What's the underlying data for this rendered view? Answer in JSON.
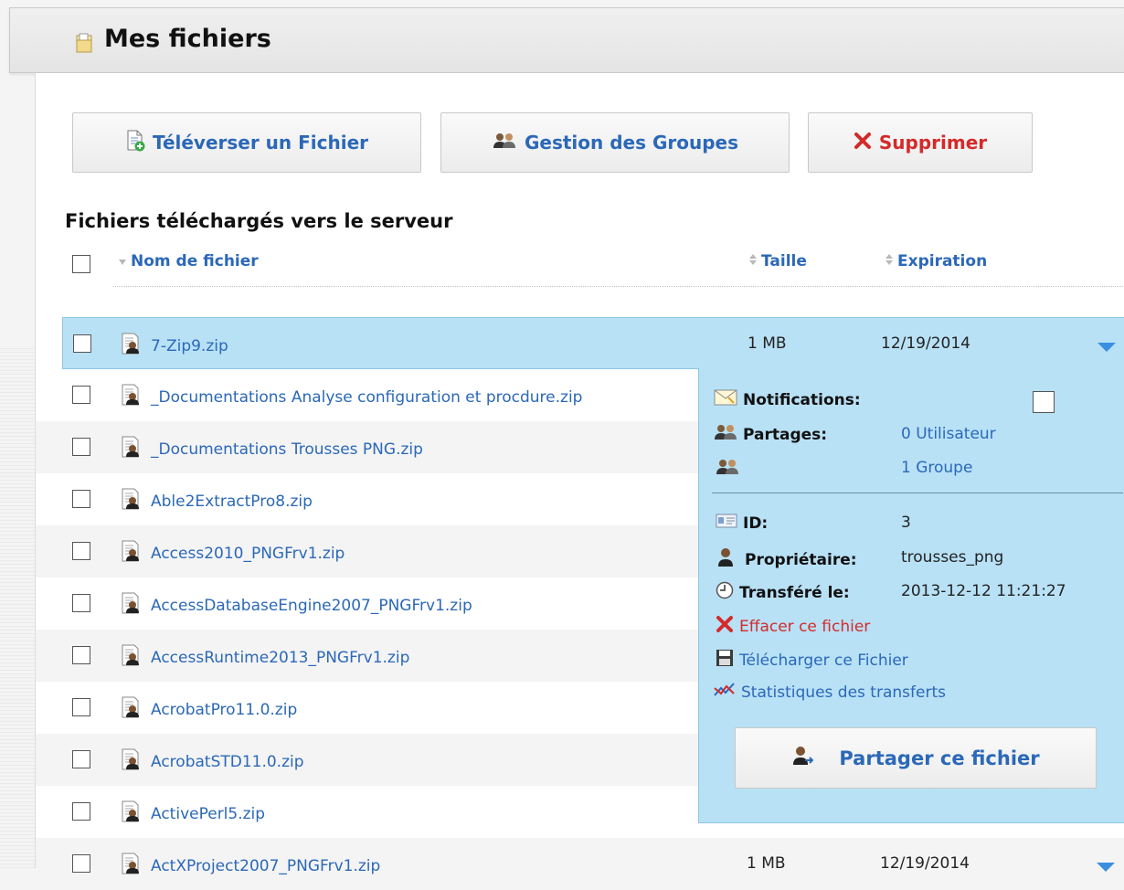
{
  "page": {
    "title": "Mes fichiers"
  },
  "toolbar": {
    "upload_label": "Téléverser un Fichier",
    "groups_label": "Gestion des Groupes",
    "delete_label": "Supprimer"
  },
  "files_section": {
    "title": "Fichiers téléchargés vers le serveur",
    "columns": {
      "name": "Nom de fichier",
      "size": "Taille",
      "expiration": "Expiration"
    }
  },
  "files": [
    {
      "name": "7-Zip9.zip",
      "size": "1 MB",
      "expiration": "12/19/2014"
    },
    {
      "name": "_Documentations Analyse configuration et procdure.zip"
    },
    {
      "name": "_Documentations Trousses PNG.zip"
    },
    {
      "name": "Able2ExtractPro8.zip"
    },
    {
      "name": "Access2010_PNGFrv1.zip"
    },
    {
      "name": "AccessDatabaseEngine2007_PNGFrv1.zip"
    },
    {
      "name": "AccessRuntime2013_PNGFrv1.zip"
    },
    {
      "name": "AcrobatPro11.0.zip"
    },
    {
      "name": "AcrobatSTD11.0.zip"
    },
    {
      "name": "ActivePerl5.zip"
    },
    {
      "name": "ActXProject2007_PNGFrv1.zip",
      "size": "1 MB",
      "expiration": "12/19/2014"
    }
  ],
  "details": {
    "notifications_label": "Notifications:",
    "shares_label": "Partages:",
    "users_link": "0 Utilisateur",
    "groups_link": "1 Groupe",
    "id_label": "ID:",
    "id_value": "3",
    "owner_label": "Propriétaire:",
    "owner_value": "trousses_png",
    "transferred_label": "Transféré le:",
    "transferred_value": "2013-12-12 11:21:27",
    "delete_link": "Effacer ce fichier",
    "download_link": "Télécharger ce Fichier",
    "stats_link": "Statistiques des transferts",
    "share_button": "Partager ce fichier"
  },
  "colors": {
    "link": "#2b68b8",
    "danger": "#d42a2a",
    "selected_bg": "#b8e1f6"
  }
}
